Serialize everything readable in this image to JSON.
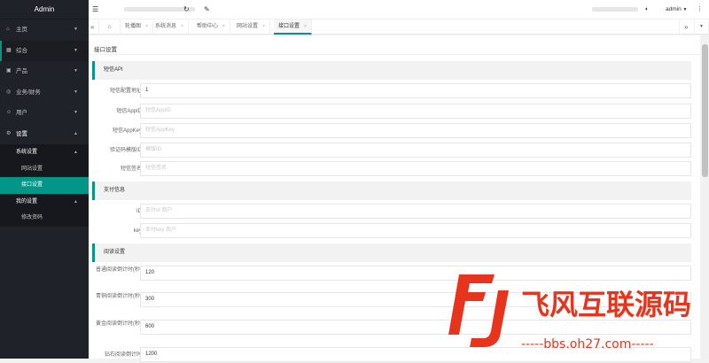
{
  "app": {
    "title": "Admin"
  },
  "sidebar": {
    "items": [
      {
        "label": "主页",
        "icon": "home-icon"
      },
      {
        "label": "综合",
        "icon": "grid-icon"
      },
      {
        "label": "产品",
        "icon": "product-icon"
      },
      {
        "label": "业务/财务",
        "icon": "finance-icon"
      },
      {
        "label": "用户",
        "icon": "user-icon"
      },
      {
        "label": "设置",
        "icon": "gear-icon"
      }
    ],
    "groups": [
      {
        "label": "系统设置",
        "items": [
          "网站设置",
          "接口设置"
        ]
      },
      {
        "label": "我的设置",
        "items": [
          "修改资码"
        ]
      }
    ]
  },
  "topbar": {
    "user": "admin"
  },
  "tabs": [
    "轮播图",
    "系统消息",
    "帮助中心",
    "网站设置",
    "接口设置"
  ],
  "page": {
    "title": "接口设置"
  },
  "sections": [
    {
      "title": "短信API",
      "fields": [
        {
          "label": "短信配置地址",
          "value": "1",
          "placeholder": ""
        },
        {
          "label": "短信AppID",
          "value": "",
          "placeholder": "短信AppID"
        },
        {
          "label": "短信AppKey",
          "value": "",
          "placeholder": "短信AppKey"
        },
        {
          "label": "验证码模版ID",
          "value": "",
          "placeholder": "模版ID"
        },
        {
          "label": "短信签名",
          "value": "",
          "placeholder": "短信签名"
        }
      ]
    },
    {
      "title": "支付信息",
      "fields": [
        {
          "label": "ID",
          "value": "",
          "placeholder": "支付id 商户"
        },
        {
          "label": "key",
          "value": "",
          "placeholder": "支付key 商户"
        }
      ]
    },
    {
      "title": "阅读设置",
      "fields": [
        {
          "label": "普通阅读倒计时(秒)",
          "value": "120"
        },
        {
          "label": "青铜阅读倒计时(秒)",
          "value": "300"
        },
        {
          "label": "黄金阅读倒计时(秒)",
          "value": "600"
        },
        {
          "label": "钻石阅读倒计时",
          "value": "1200"
        }
      ]
    }
  ],
  "watermark": {
    "logo": "FJ",
    "text": "飞风互联源码",
    "url": "-----bbs.oh27.com-----"
  },
  "colors": {
    "accent": "#009688",
    "sidebar": "#20222a",
    "watermark": "#e8341c"
  }
}
